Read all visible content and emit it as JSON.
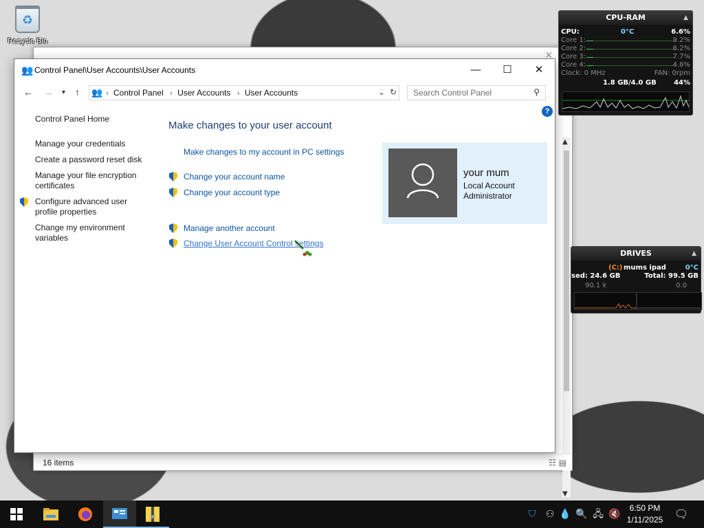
{
  "desktop": {
    "recycle_bin_label": "Recycle Bin"
  },
  "window": {
    "title": "Control Panel\\User Accounts\\User Accounts",
    "breadcrumbs": [
      "Control Panel",
      "User Accounts",
      "User Accounts"
    ],
    "search_placeholder": "Search Control Panel",
    "help_label": "?"
  },
  "left_nav": {
    "home": "Control Panel Home",
    "credentials": "Manage your credentials",
    "reset_disk": "Create a password reset disk",
    "encryption_1": "Manage your file encryption",
    "encryption_2": "certificates",
    "profile_1": "Configure advanced user",
    "profile_2": "profile properties",
    "env_1": "Change my environment",
    "env_2": "variables"
  },
  "main": {
    "heading": "Make changes to your user account",
    "pc_settings": "Make changes to my account in PC settings",
    "change_name": "Change your account name",
    "change_type": "Change your account type",
    "manage_another": "Manage another account",
    "uac_settings": "Change User Account Control settings"
  },
  "user": {
    "name": "your mum",
    "account_type": "Local Account",
    "role": "Administrator"
  },
  "back_window": {
    "status_items": "16 items"
  },
  "cpu_gadget": {
    "title": "CPU-RAM",
    "cpu_label": "CPU:",
    "cpu_temp": "0°C",
    "cpu_pct": "6.6%",
    "cores": [
      {
        "label": "Core 1:",
        "pct": "9.2%"
      },
      {
        "label": "Core 2:",
        "pct": "6.2%"
      },
      {
        "label": "Core 3:",
        "pct": "7.7%"
      },
      {
        "label": "Core 4:",
        "pct": "4.6%"
      }
    ],
    "clock": "Clock: 0 MHz",
    "fan": "FAN: 0rpm",
    "ram_used": "1.8 GB/4.0 GB",
    "ram_pct": "44%"
  },
  "drives_gadget": {
    "title": "DRIVES",
    "drive_letter": "(C:)",
    "drive_name": "mums ipad",
    "drive_temp": "0°C",
    "used": "sed: 24.6 GB",
    "total": "Total: 99.5 GB",
    "read_rate": "90.1 k",
    "write_rate": "0.0"
  },
  "taskbar": {
    "time": "6:50 PM",
    "date": "1/11/2025"
  }
}
